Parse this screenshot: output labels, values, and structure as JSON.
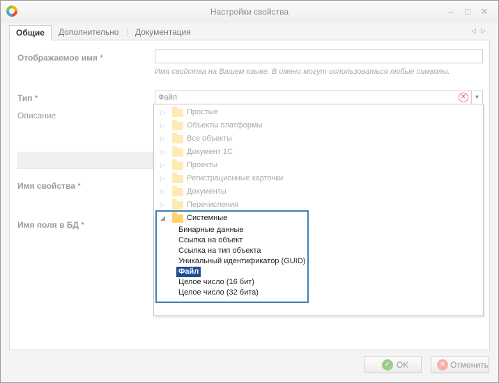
{
  "window": {
    "title": "Настройки свойства"
  },
  "tabs": [
    {
      "label": "Общие",
      "active": true
    },
    {
      "label": "Дополнительно",
      "active": false
    },
    {
      "label": "Документация",
      "active": false
    }
  ],
  "form": {
    "display_name": {
      "label": "Отображаемое имя",
      "required": "*",
      "value": "",
      "hint": "Имя свойства на Вашем языке. В имени могут использоваться любые символы."
    },
    "type": {
      "label": "Тип",
      "required": "*",
      "value": "Файл"
    },
    "description": {
      "label": "Описание"
    },
    "property_name": {
      "label": "Имя свойства",
      "required": "*"
    },
    "db_field_name": {
      "label": "Имя поля в БД",
      "required": "*"
    }
  },
  "type_tree": {
    "collapsed_groups": [
      "Простые",
      "Объекты платформы",
      "Все объекты",
      "Документ 1С",
      "Проекты",
      "Регистрационные карточки",
      "Документы",
      "Перечисления"
    ],
    "open_group": {
      "label": "Системные",
      "items": [
        "Бинарные данные",
        "Ссылка на объект",
        "Ссылка на тип объекта",
        "Уникальный идентификатор (GUID)",
        "Файл",
        "Целое число (16 бит)",
        "Целое число (32 бита)"
      ],
      "selected": "Файл"
    }
  },
  "footer": {
    "ok_label": "OK",
    "cancel_label": "Отменить"
  },
  "colors": {
    "selection": "#1e4f93",
    "focus_border": "#3f7fae",
    "folder": "#ffd36a",
    "required_mark": "#e0684f"
  }
}
